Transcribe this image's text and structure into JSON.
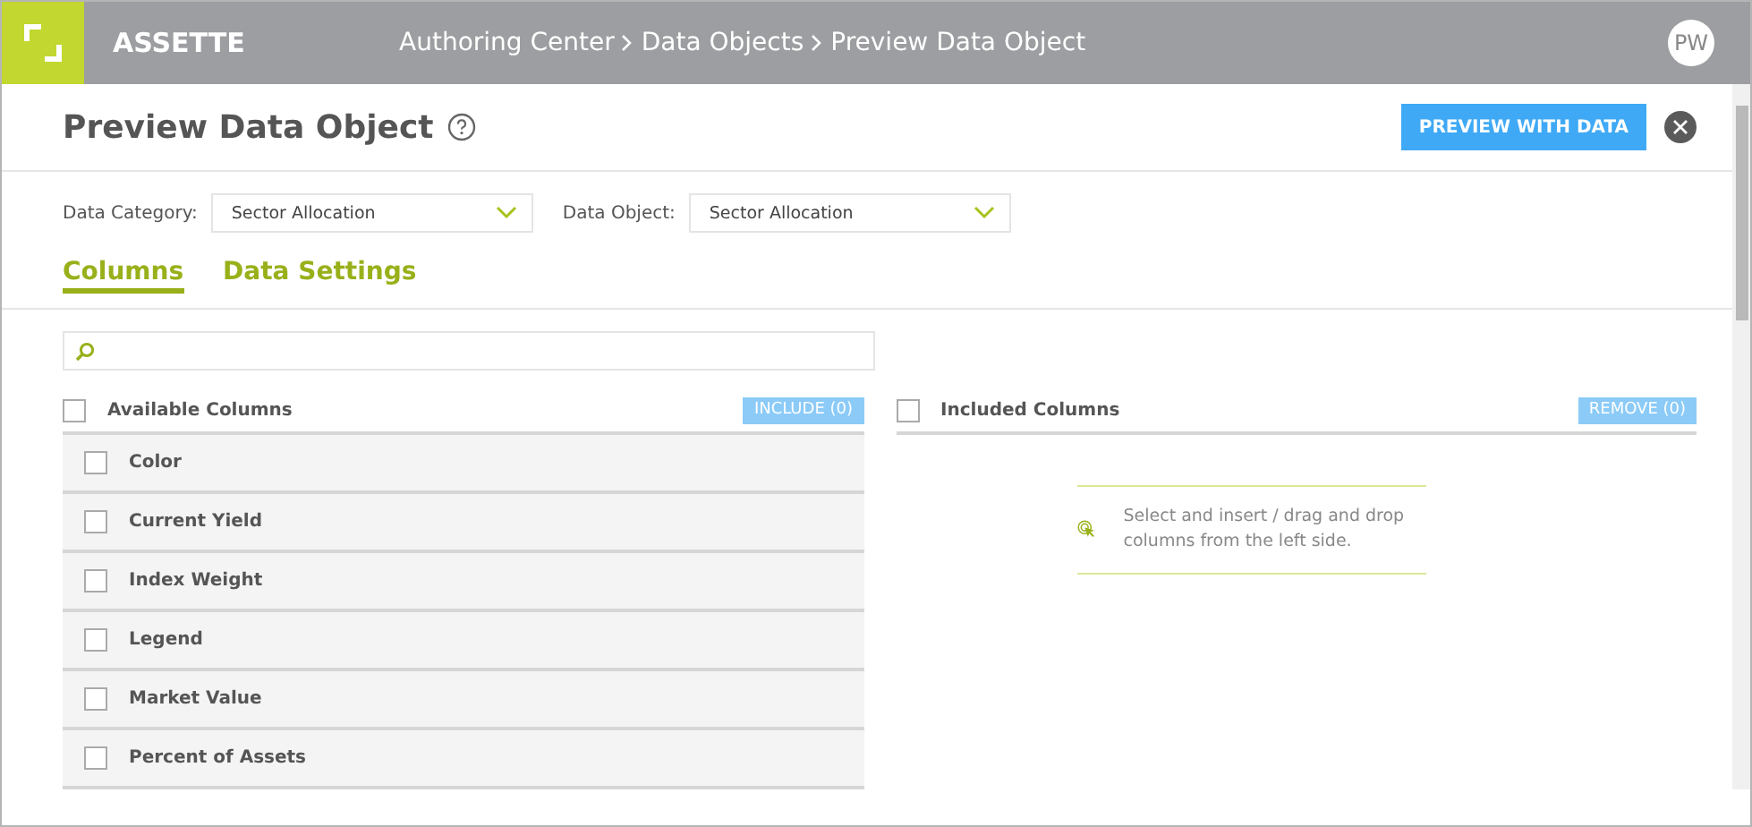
{
  "app": {
    "brand": "ASSETTE",
    "breadcrumb": [
      "Authoring Center",
      "Data Objects",
      "Preview Data Object"
    ],
    "avatar": "PW"
  },
  "page": {
    "title": "Preview Data Object",
    "primary_button": "PREVIEW WITH DATA"
  },
  "filters": [
    {
      "label": "Data Category:",
      "value": "Sector Allocation"
    },
    {
      "label": "Data Object:",
      "value": "Sector Allocation"
    }
  ],
  "tabs": [
    {
      "label": "Columns",
      "selected": true
    },
    {
      "label": "Data Settings",
      "selected": false
    }
  ],
  "available": {
    "title": "Available Columns",
    "checked": false,
    "button": "INCLUDE (0)",
    "items": [
      {
        "label": "Color",
        "checked": false
      },
      {
        "label": "Current Yield",
        "checked": false
      },
      {
        "label": "Index Weight",
        "checked": false
      },
      {
        "label": "Legend",
        "checked": false
      },
      {
        "label": "Market Value",
        "checked": false
      },
      {
        "label": "Percent of Assets",
        "checked": false
      }
    ]
  },
  "included": {
    "title": "Included Columns",
    "checked": false,
    "button": "REMOVE (0)",
    "empty_message": "Select and insert / drag and drop columns from the left side."
  }
}
